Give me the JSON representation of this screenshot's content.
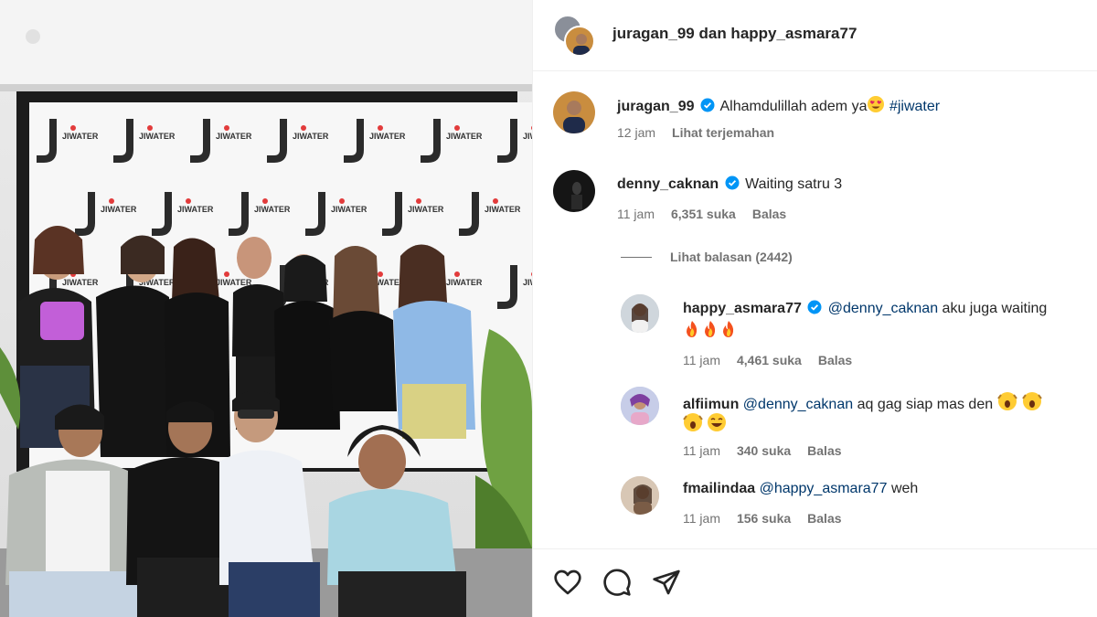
{
  "post": {
    "header_title": "juragan_99 dan happy_asmara77"
  },
  "comments": [
    {
      "username": "juragan_99",
      "verified": true,
      "text": "Alhamdulillah adem ya",
      "hashtag": "#jiwater",
      "time": "12 jam",
      "action": "Lihat terjemahan"
    },
    {
      "username": "denny_caknan",
      "verified": true,
      "text": "Waiting satru 3",
      "time": "11 jam",
      "likes": "6,351 suka",
      "reply": "Balas",
      "view_replies": "Lihat balasan (2442)"
    }
  ],
  "replies": [
    {
      "username": "happy_asmara77",
      "verified": true,
      "mention": "@denny_caknan",
      "text": "aku juga waiting",
      "time": "11 jam",
      "likes": "4,461 suka",
      "reply": "Balas"
    },
    {
      "username": "alfiimun",
      "mention": "@denny_caknan",
      "text": "aq gag siap mas den",
      "time": "11 jam",
      "likes": "340 suka",
      "reply": "Balas"
    },
    {
      "username": "fmailindaa",
      "mention": "@happy_asmara77",
      "text": "weh",
      "time": "11 jam",
      "likes": "156 suka",
      "reply": "Balas"
    }
  ],
  "photo": {
    "backdrop_brand": "JIWATER"
  },
  "icons": [
    "heart-icon",
    "comment-icon",
    "share-icon",
    "verified-icon"
  ],
  "colors": {
    "verified": "#0095f6",
    "link": "#00376b",
    "muted": "#737373"
  }
}
